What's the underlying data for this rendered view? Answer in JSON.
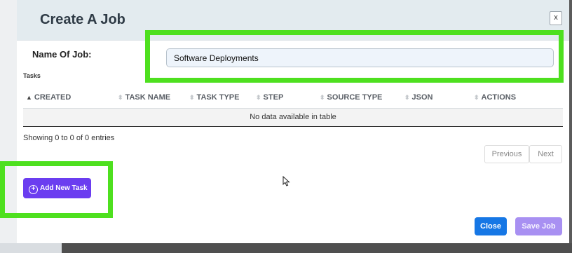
{
  "modal": {
    "title": "Create A Job",
    "close_x": "x"
  },
  "form": {
    "name_label": "Name Of Job:",
    "name_value": "Software Deployments"
  },
  "tasks": {
    "heading": "Tasks",
    "columns": [
      {
        "label": "CREATED",
        "sort": "ascending"
      },
      {
        "label": "TASK NAME",
        "sort": "none"
      },
      {
        "label": "TASK TYPE",
        "sort": "none"
      },
      {
        "label": "STEP",
        "sort": "none"
      },
      {
        "label": "SOURCE TYPE",
        "sort": "none"
      },
      {
        "label": "JSON",
        "sort": "none"
      },
      {
        "label": "ACTIONS",
        "sort": "none"
      }
    ],
    "empty_message": "No data available in table",
    "info": "Showing 0 to 0 of 0 entries",
    "pagination": {
      "previous": "Previous",
      "next": "Next"
    },
    "add_button": "Add New Task"
  },
  "footer": {
    "close": "Close",
    "save": "Save Job"
  },
  "colors": {
    "highlight": "#4ee01f",
    "add_button": "#6b3df0",
    "close_button": "#1677e5",
    "save_button_disabled": "#a890f2"
  },
  "icons": {
    "sort": "sort-arrows-icon",
    "sort_active": "sort-up-icon",
    "add": "plus-circle-icon",
    "cursor": "mouse-pointer-icon"
  }
}
